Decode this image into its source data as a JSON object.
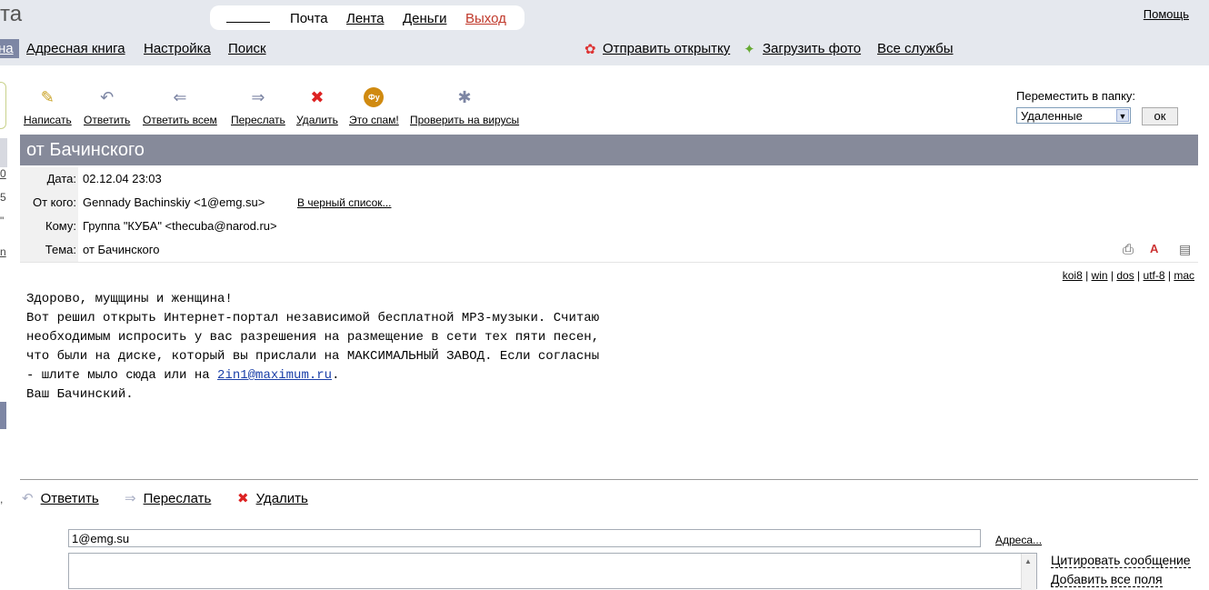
{
  "top": {
    "brand_fragment": "та",
    "nav": [
      "Почта",
      "Лента",
      "Деньги",
      "Выход"
    ],
    "help": "Помощь"
  },
  "menu": {
    "mail_tab": "на",
    "items": [
      "Адресная книга",
      "Настройка",
      "Поиск"
    ],
    "services": [
      "Отправить открытку",
      "Загрузить фото",
      "Все службы"
    ]
  },
  "toolbar": {
    "buttons": [
      {
        "label": "Написать",
        "icon": "pencil-icon"
      },
      {
        "label": "Ответить",
        "icon": "reply-icon"
      },
      {
        "label": "Ответить всем",
        "icon": "reply-all-icon"
      },
      {
        "label": "Переслать",
        "icon": "forward-icon"
      },
      {
        "label": "Удалить",
        "icon": "delete-icon"
      },
      {
        "label": "Это спам!",
        "icon": "spam-icon"
      },
      {
        "label": "Проверить на вирусы",
        "icon": "virus-check-icon"
      }
    ],
    "move_label": "Переместить в папку:",
    "folder_selected": "Удаленные",
    "ok": "ок"
  },
  "message": {
    "subject_title": "от Бачинского",
    "headers": {
      "date_label": "Дата:",
      "date": "02.12.04 23:03",
      "from_label": "От кого:",
      "from": "Gennady Bachinskiy <1@emg.su>",
      "blacklist": "В черный список...",
      "to_label": "Кому:",
      "to": "Группа \"КУБА\" <thecuba@narod.ru>",
      "subject_label": "Тема:",
      "subject": "от Бачинского"
    },
    "encodings": [
      "koi8",
      "win",
      "dos",
      "utf-8",
      "mac"
    ],
    "body_lines": [
      "Здорово, мущщины и женщина!",
      "Вот решил открыть Интернет-портал независимой бесплатной МР3-музыки. Считаю",
      "необходимым испросить у вас разрешения на размещение в сети тех пяти песен,",
      "что были на диске, который вы прислали на МАКСИМАЛЬНЫЙ ЗАВОД. Если согласны"
    ],
    "body_line5_prefix": "- шлите мыло сюда или на ",
    "body_email": "2in1@maximum.ru",
    "body_line5_suffix": ".",
    "body_signature": "Ваш Бачинский."
  },
  "actions": [
    "Ответить",
    "Переслать",
    "Удалить"
  ],
  "reply": {
    "to_value": "1@emg.su",
    "addresses_link": "Адреса...",
    "quote_link": "Цитировать сообщение",
    "add_all_link": "Добавить все поля"
  },
  "left_fragments": [
    "0",
    "5",
    "\"",
    "n",
    ","
  ],
  "colors": {
    "top_band": "#e5e8ee",
    "subject_bar": "#868a9a",
    "exit_link": "#c0392b",
    "body_link": "#1a3fa8"
  }
}
